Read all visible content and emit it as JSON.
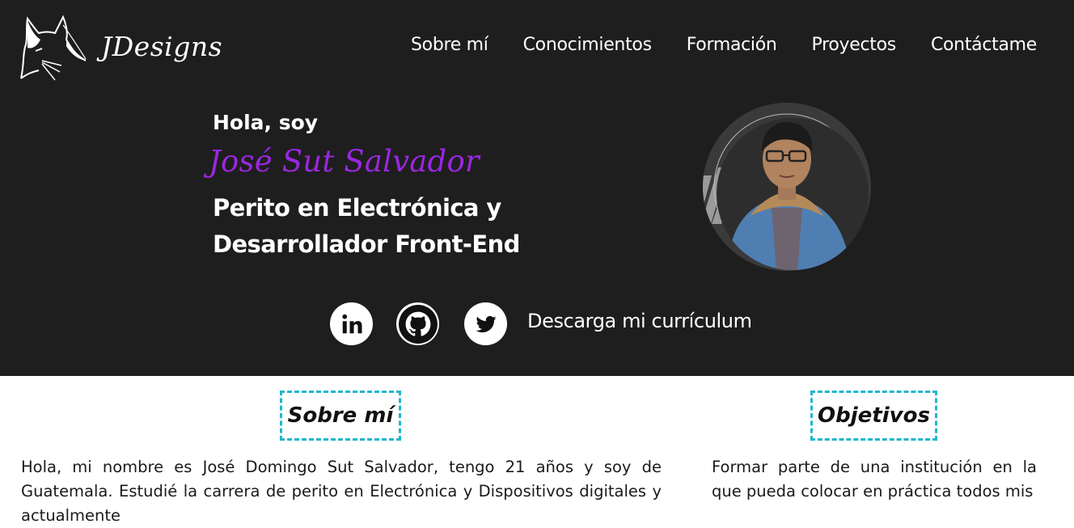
{
  "header": {
    "brand": "JDesigns",
    "nav": [
      "Sobre mí",
      "Conocimientos",
      "Formación",
      "Proyectos",
      "Contáctame"
    ]
  },
  "hero": {
    "greeting": "Hola, soy",
    "name": "José Sut Salvador",
    "role_line1": "Perito en Electrónica y",
    "role_line2": "Desarrollador Front-End",
    "cv_link": "Descarga mi currículum",
    "social": [
      "linkedin-icon",
      "github-icon",
      "twitter-icon"
    ]
  },
  "about": {
    "title": "Sobre mí",
    "text": "Hola, mi nombre es José Domingo Sut Salvador, tengo 21 años y soy de Guatemala. Estudié la carrera de perito en Electrónica y Dispositivos digitales y actualmente"
  },
  "objectives": {
    "title": "Objetivos",
    "text": "Formar parte de una institución en la que pueda colocar en práctica todos mis"
  },
  "colors": {
    "hero_bg": "#1e1e1e",
    "accent_name": "#9b27e0",
    "section_border": "#1fb7cc"
  }
}
